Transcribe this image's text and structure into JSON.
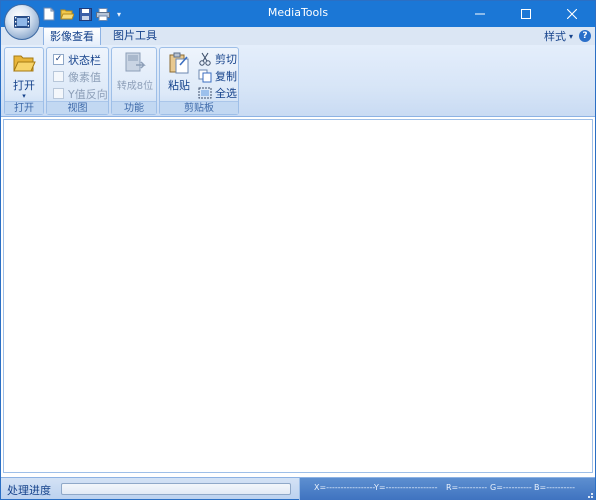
{
  "window": {
    "title": "MediaTools"
  },
  "quick_access": {
    "icons": [
      "new-file-icon",
      "open-folder-icon",
      "save-icon",
      "print-icon"
    ],
    "dropdown": "▾"
  },
  "window_controls": [
    "minimize-icon",
    "maximize-icon",
    "close-icon"
  ],
  "tabs": [
    {
      "label": "影像查看",
      "active": true
    },
    {
      "label": "图片工具",
      "active": false
    }
  ],
  "style_menu": {
    "label": "样式",
    "caret": "▾",
    "help": "?"
  },
  "ribbon": {
    "open_group": {
      "button_label": "打开",
      "caret": "▾",
      "group_label": "打开"
    },
    "view_group": {
      "checkboxes": [
        {
          "label": "状态栏",
          "checked": true,
          "enabled": true
        },
        {
          "label": "像素值",
          "checked": false,
          "enabled": false
        },
        {
          "label": "Y值反向",
          "checked": false,
          "enabled": false
        }
      ],
      "group_label": "视图"
    },
    "function_group": {
      "button_label": "转成8位",
      "enabled": false,
      "group_label": "功能"
    },
    "clipboard_group": {
      "paste_label": "粘贴",
      "cut_label": "剪切",
      "copy_label": "复制",
      "select_all_label": "全选",
      "group_label": "剪贴板"
    }
  },
  "statusbar": {
    "progress_label": "处理进度",
    "progress": 0,
    "x_readout": "X=-----------------",
    "y_readout": "Y=------------------",
    "r_readout": "R=----------",
    "g_readout": "G=----------",
    "b_readout": "B=----------"
  },
  "colors": {
    "titlebar": "#1b77d6",
    "ribbon_text": "#15428b",
    "progress_fill": "#4ea34e"
  }
}
